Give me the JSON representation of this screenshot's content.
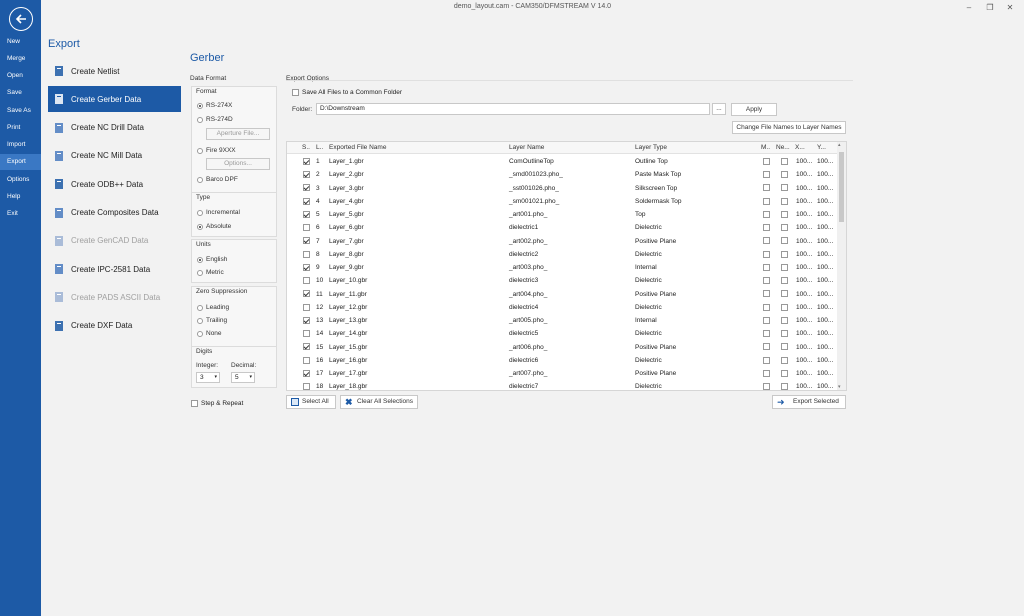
{
  "window": {
    "title": "demo_layout.cam - CAM350/DFMSTREAM V 14.0"
  },
  "nav": [
    "New",
    "Merge",
    "Open",
    "Save",
    "Save As",
    "Print",
    "Import",
    "Export",
    "Options",
    "Help",
    "Exit"
  ],
  "export_panel": {
    "title": "Export",
    "items": [
      {
        "label": "Create Netlist",
        "state": "normal"
      },
      {
        "label": "Create Gerber Data",
        "state": "active"
      },
      {
        "label": "Create NC Drill Data",
        "state": "normal"
      },
      {
        "label": "Create NC Mill Data",
        "state": "normal"
      },
      {
        "label": "Create ODB++ Data",
        "state": "normal"
      },
      {
        "label": "Create Composites Data",
        "state": "normal"
      },
      {
        "label": "Create GenCAD Data",
        "state": "disabled"
      },
      {
        "label": "Create IPC-2581 Data",
        "state": "normal"
      },
      {
        "label": "Create PADS ASCII Data",
        "state": "disabled"
      },
      {
        "label": "Create DXF Data",
        "state": "normal"
      }
    ]
  },
  "page_title": "Gerber",
  "data_format": {
    "label": "Data Format",
    "format_label": "Format",
    "rs274x": "RS-274X",
    "rs274d": "RS-274D",
    "aperture_btn": "Aperture File...",
    "fire": "Fire 9XXX",
    "options_btn": "Options...",
    "barco": "Barco DPF",
    "type_label": "Type",
    "incremental": "Incremental",
    "absolute": "Absolute",
    "units_label": "Units",
    "english": "English",
    "metric": "Metric",
    "zero_label": "Zero Suppression",
    "leading": "Leading",
    "trailing": "Trailing",
    "none": "None",
    "digits_label": "Digits",
    "integer_label": "Integer:",
    "integer_value": "3",
    "decimal_label": "Decimal:",
    "decimal_value": "5",
    "step_repeat": "Step & Repeat"
  },
  "export_options": {
    "label": "Export Options",
    "save_common": "Save All Files to a Common Folder",
    "folder_label": "Folder:",
    "folder_value": "D:\\Downstream",
    "browse_btn": "...",
    "apply_btn": "Apply",
    "change_names_btn": "Change File Names to Layer Names"
  },
  "table": {
    "headers": [
      "S..",
      "L..",
      "Exported File Name",
      "Layer Name",
      "Layer Type",
      "M..",
      "Ne...",
      "X...",
      "Y..."
    ],
    "rows": [
      {
        "s": true,
        "n": "1",
        "file": "Layer_1.gbr",
        "layer": "ComOutlineTop",
        "type": "Outline Top",
        "x": "100...",
        "y": "100..."
      },
      {
        "s": true,
        "n": "2",
        "file": "Layer_2.gbr",
        "layer": "_smd001023.pho_",
        "type": "Paste Mask Top",
        "x": "100...",
        "y": "100..."
      },
      {
        "s": true,
        "n": "3",
        "file": "Layer_3.gbr",
        "layer": "_sst001026.pho_",
        "type": "Silkscreen Top",
        "x": "100...",
        "y": "100..."
      },
      {
        "s": true,
        "n": "4",
        "file": "Layer_4.gbr",
        "layer": "_sm001021.pho_",
        "type": "Soldermask Top",
        "x": "100...",
        "y": "100..."
      },
      {
        "s": true,
        "n": "5",
        "file": "Layer_5.gbr",
        "layer": "_art001.pho_",
        "type": "Top",
        "x": "100...",
        "y": "100..."
      },
      {
        "s": false,
        "n": "6",
        "file": "Layer_6.gbr",
        "layer": "dielectric1",
        "type": "Dielectric",
        "x": "100...",
        "y": "100..."
      },
      {
        "s": true,
        "n": "7",
        "file": "Layer_7.gbr",
        "layer": "_art002.pho_",
        "type": "Positive Plane",
        "x": "100...",
        "y": "100..."
      },
      {
        "s": false,
        "n": "8",
        "file": "Layer_8.gbr",
        "layer": "dielectric2",
        "type": "Dielectric",
        "x": "100...",
        "y": "100..."
      },
      {
        "s": true,
        "n": "9",
        "file": "Layer_9.gbr",
        "layer": "_art003.pho_",
        "type": "Internal",
        "x": "100...",
        "y": "100..."
      },
      {
        "s": false,
        "n": "10",
        "file": "Layer_10.gbr",
        "layer": "dielectric3",
        "type": "Dielectric",
        "x": "100...",
        "y": "100..."
      },
      {
        "s": true,
        "n": "11",
        "file": "Layer_11.gbr",
        "layer": "_art004.pho_",
        "type": "Positive Plane",
        "x": "100...",
        "y": "100..."
      },
      {
        "s": false,
        "n": "12",
        "file": "Layer_12.gbr",
        "layer": "dielectric4",
        "type": "Dielectric",
        "x": "100...",
        "y": "100..."
      },
      {
        "s": true,
        "n": "13",
        "file": "Layer_13.gbr",
        "layer": "_art005.pho_",
        "type": "Internal",
        "x": "100...",
        "y": "100..."
      },
      {
        "s": false,
        "n": "14",
        "file": "Layer_14.gbr",
        "layer": "dielectric5",
        "type": "Dielectric",
        "x": "100...",
        "y": "100..."
      },
      {
        "s": true,
        "n": "15",
        "file": "Layer_15.gbr",
        "layer": "_art006.pho_",
        "type": "Positive Plane",
        "x": "100...",
        "y": "100..."
      },
      {
        "s": false,
        "n": "16",
        "file": "Layer_16.gbr",
        "layer": "dielectric6",
        "type": "Dielectric",
        "x": "100...",
        "y": "100..."
      },
      {
        "s": true,
        "n": "17",
        "file": "Layer_17.gbr",
        "layer": "_art007.pho_",
        "type": "Positive Plane",
        "x": "100...",
        "y": "100..."
      },
      {
        "s": false,
        "n": "18",
        "file": "Layer_18.gbr",
        "layer": "dielectric7",
        "type": "Dielectric",
        "x": "100...",
        "y": "100..."
      }
    ]
  },
  "footer": {
    "select_all": "Select All",
    "clear_all": "Clear All Selections",
    "export_selected": "Export Selected"
  }
}
